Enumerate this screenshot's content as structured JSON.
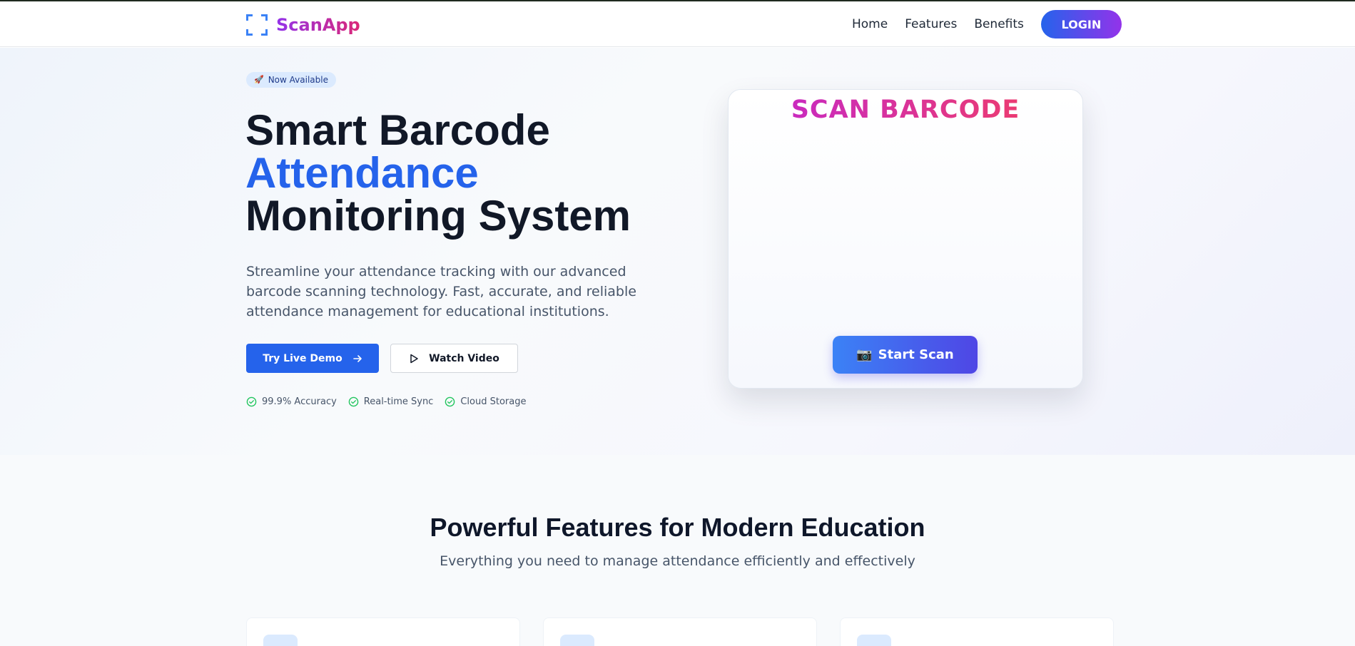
{
  "nav": {
    "brand": "ScanApp",
    "links": [
      "Home",
      "Features",
      "Benefits"
    ],
    "login_label": "LOGIN"
  },
  "hero": {
    "badge_icon": "🚀",
    "badge": "Now Available",
    "title_line1": "Smart Barcode",
    "title_line2": "Attendance",
    "title_line3": "Monitoring System",
    "description": "Streamline your attendance tracking with our advanced barcode scanning technology. Fast, accurate, and reliable attendance management for educational institutions.",
    "demo_label": "Try Live Demo",
    "video_label": "Watch Video",
    "checks": [
      "99.9% Accuracy",
      "Real-time Sync",
      "Cloud Storage"
    ]
  },
  "scanner": {
    "title": "SCAN BARCODE",
    "button_icon": "📷",
    "button_label": "Start Scan"
  },
  "features": {
    "title": "Powerful Features for Modern Education",
    "subtitle": "Everything you need to manage attendance efficiently and effectively"
  },
  "colors": {
    "primary": "#2563eb",
    "accent_purple": "#9333ea",
    "accent_pink": "#db2777",
    "success": "#22c55e"
  }
}
